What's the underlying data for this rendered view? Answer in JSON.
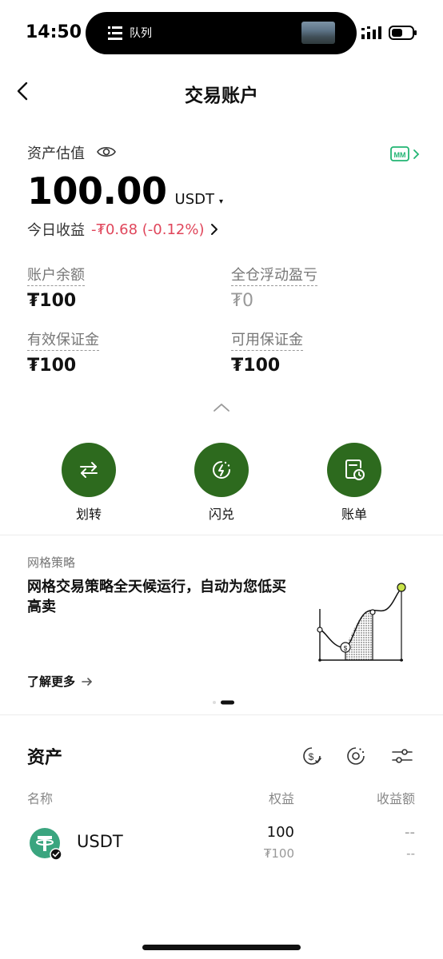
{
  "status_bar": {
    "time": "14:50",
    "island_label": "队列",
    "icons": [
      "queue-icon",
      "signal-icon",
      "battery-icon"
    ]
  },
  "nav": {
    "title": "交易账户",
    "back_icon": "chevron-left-icon"
  },
  "overview": {
    "estimation_label": "资产估值",
    "balance": "100.00",
    "unit": "USDT",
    "unit_caret": "▾",
    "today_pnl_label": "今日收益",
    "today_pnl_value": "-₮0.68 (-0.12%)",
    "pnl_color": "#e0465b"
  },
  "stats": [
    {
      "label": "账户余额",
      "value": "₮100"
    },
    {
      "label": "全仓浮动盈亏",
      "value": "₮0"
    },
    {
      "label": "有效保证金",
      "value": "₮100"
    },
    {
      "label": "可用保证金",
      "value": "₮100"
    }
  ],
  "actions": [
    {
      "label": "划转",
      "icon": "transfer-icon"
    },
    {
      "label": "闪兑",
      "icon": "flash-convert-icon"
    },
    {
      "label": "账单",
      "icon": "bill-icon"
    }
  ],
  "strategy_banner": {
    "tag": "网格策略",
    "title": "网格交易策略全天候运行，自动为您低买高卖",
    "learn_more": "了解更多",
    "pager_total": 2,
    "pager_active": 2
  },
  "assets": {
    "title": "资产",
    "columns": {
      "name": "名称",
      "equity": "权益",
      "earnings": "收益额"
    },
    "rows": [
      {
        "coin": "USDT",
        "equity": "100",
        "equity_sub": "₮100",
        "earnings": "--",
        "earnings_sub": "--"
      }
    ]
  },
  "colors": {
    "accent": "#2d6a1e",
    "brand_badge": "#22b573",
    "loss": "#e0465b",
    "tether": "#3aa57f"
  }
}
